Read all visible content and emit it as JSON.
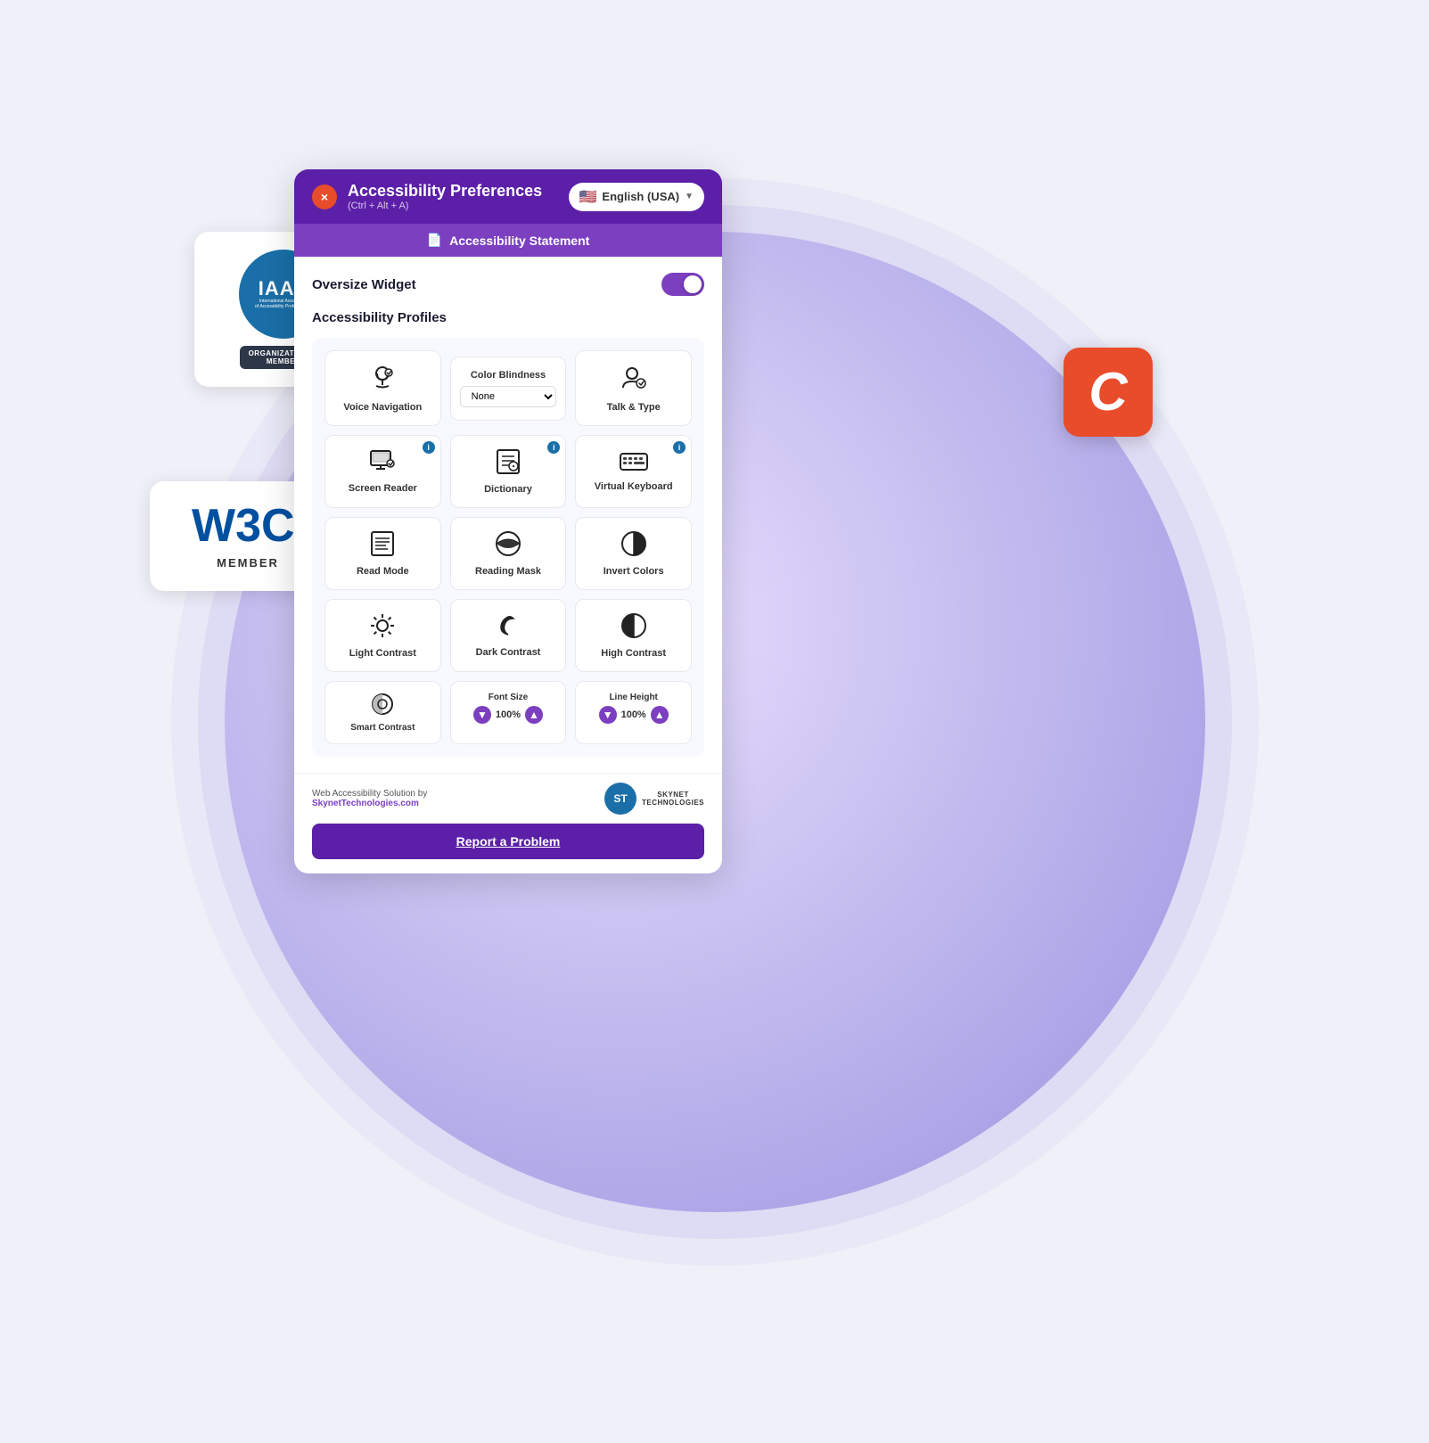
{
  "page": {
    "bg_color": "#e8e0ff"
  },
  "iaap": {
    "title": "IAAP",
    "subtitle": "International Association\nof Accessibility Professionals",
    "org_label": "ORGANIZATIONAL",
    "member_label": "MEMBER"
  },
  "w3c": {
    "logo": "W3C",
    "reg": "®",
    "member": "MEMBER"
  },
  "c_card": {
    "letter": "C"
  },
  "panel": {
    "title": "Accessibility Preferences",
    "shortcut": "(Ctrl + Alt + A)",
    "lang": "English (USA)",
    "statement": "Accessibility Statement",
    "oversize_label": "Oversize Widget",
    "profiles_label": "Accessibility Profiles",
    "close_label": "×"
  },
  "profiles": {
    "voice_nav": "Voice Navigation",
    "color_blindness": "Color Blindness",
    "talk_type": "Talk & Type",
    "cb_default": "None"
  },
  "grid_row1": [
    {
      "label": "Screen Reader",
      "has_info": true
    },
    {
      "label": "Dictionary",
      "has_info": true
    },
    {
      "label": "Virtual Keyboard",
      "has_info": true
    }
  ],
  "grid_row2": [
    {
      "label": "Read Mode",
      "has_info": false
    },
    {
      "label": "Reading Mask",
      "has_info": false
    },
    {
      "label": "Invert Colors",
      "has_info": false
    }
  ],
  "grid_row3": [
    {
      "label": "Light Contrast",
      "has_info": false
    },
    {
      "label": "Dark Contrast",
      "has_info": false
    },
    {
      "label": "High Contrast",
      "has_info": false
    }
  ],
  "bottom": {
    "smart_contrast": "Smart Contrast",
    "font_size_label": "Font Size",
    "font_size_val": "100%",
    "line_height_label": "Line Height",
    "line_height_val": "100%"
  },
  "footer": {
    "text_prefix": "Web Accessibility Solution by",
    "link": "SkynetTechnologies.com",
    "skynet_abbr": "ST",
    "skynet_name": "SKYNET\nTECHNOLOGIES"
  },
  "report": {
    "label": "Report a Problem"
  }
}
